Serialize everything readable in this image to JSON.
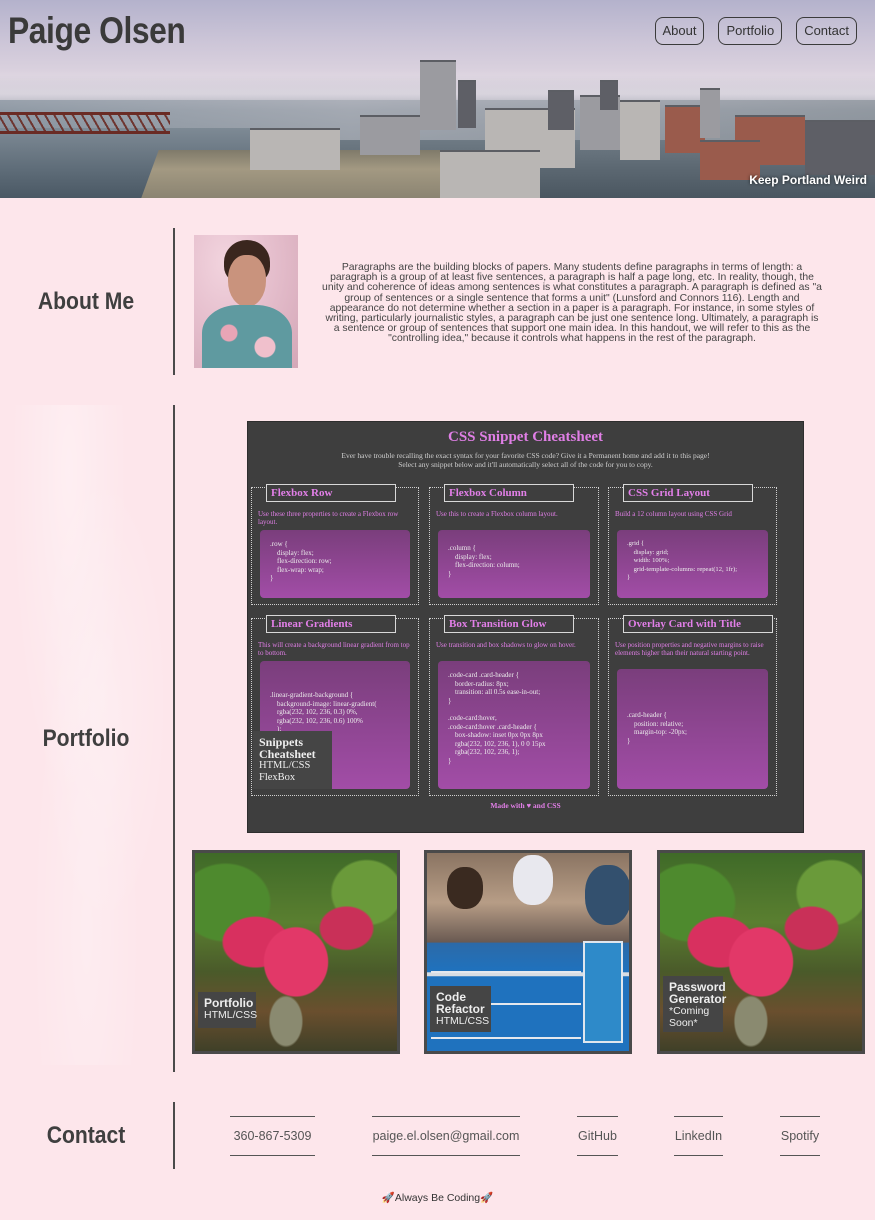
{
  "header": {
    "title": "Paige Olsen",
    "tagline": "Keep Portland Weird",
    "nav": [
      "About",
      "Portfolio",
      "Contact"
    ]
  },
  "about": {
    "heading": "About Me",
    "paragraph": "Paragraphs are the building blocks of papers. Many students define paragraphs in terms of length: a paragraph is a group of at least five sentences, a paragraph is half a page long, etc. In reality, though, the unity and coherence of ideas among sentences is what constitutes a paragraph. A paragraph is defined as \"a group of sentences or a single sentence that forms a unit\" (Lunsford and Connors 116). Length and appearance do not determine whether a section in a paper is a paragraph. For instance, in some styles of writing, particularly journalistic styles, a paragraph can be just one sentence long. Ultimately, a paragraph is a sentence or group of sentences that support one main idea. In this handout, we will refer to this as the \"controlling idea,\" because it controls what happens in the rest of the paragraph."
  },
  "portfolio": {
    "heading": "Portfolio",
    "featured": {
      "title": "Snippets Cheatsheet",
      "tech1": "HTML/CSS",
      "tech2": "FlexBox",
      "screenshot": {
        "title": "CSS Snippet Cheatsheet",
        "subtitle1": "Ever have trouble recalling the exact syntax for your favorite CSS code? Give it a Permanent home and add it to this page!",
        "subtitle2": "Select any snippet below and it'll automatically select all of the code for you to copy.",
        "footer": "Made with ♥ and CSS",
        "cards": [
          {
            "title": "Flexbox Row",
            "desc": "Use these three properties to create a Flexbox row layout.",
            "code": ".row {\n    display: flex;\n    flex-direction: row;\n    flex-wrap: wrap;\n}"
          },
          {
            "title": "Flexbox Column",
            "desc": "Use this to create a Flexbox column layout.",
            "code": ".column {\n    display: flex;\n    flex-direction: column;\n}"
          },
          {
            "title": "CSS Grid Layout",
            "desc": "Build a 12 column layout using CSS Grid",
            "code": ".grid {\n    display: grid;\n    width: 100%;\n    grid-template-columns: repeat(12, 1fr);\n}"
          },
          {
            "title": "Linear Gradients",
            "desc": "This will create a background linear gradient from top to bottom.",
            "code": ".linear-gradient-background {\n    background-image: linear-gradient(\n    rgba(232, 102, 236, 0.3) 0%,\n    rgba(232, 102, 236, 0.6) 100%\n    );\n}"
          },
          {
            "title": "Box Transition Glow",
            "desc": "Use transition and box shadows to glow on hover.",
            "code": ".code-card .card-header {\n    border-radius: 8px;\n    transition: all 0.5s ease-in-out;\n}\n\n.code-card:hover,\n.code-card:hover .card-header {\n    box-shadow: inset 0px 0px 8px\n    rgba(232, 102, 236, 1), 0 0 15px\n    rgba(232, 102, 236, 1);\n}"
          },
          {
            "title": "Overlay Card with Title",
            "desc": "Use position properties and negative margins to raise elements higher than their natural starting point.",
            "code": ".card-header {\n    position: relative;\n    margin-top: -20px;\n}"
          }
        ]
      }
    },
    "projects": [
      {
        "title": "Portfolio",
        "tech": "HTML/CSS"
      },
      {
        "title": "Code Refactor",
        "tech": "HTML/CSS"
      },
      {
        "title": "Password Generator",
        "tech": "*Coming Soon*"
      }
    ]
  },
  "contact": {
    "heading": "Contact",
    "links": [
      "360-867-5309",
      "paige.el.olsen@gmail.com",
      "GitHub",
      "LinkedIn",
      "Spotify"
    ]
  },
  "footer": {
    "text": "Always Be Coding"
  }
}
